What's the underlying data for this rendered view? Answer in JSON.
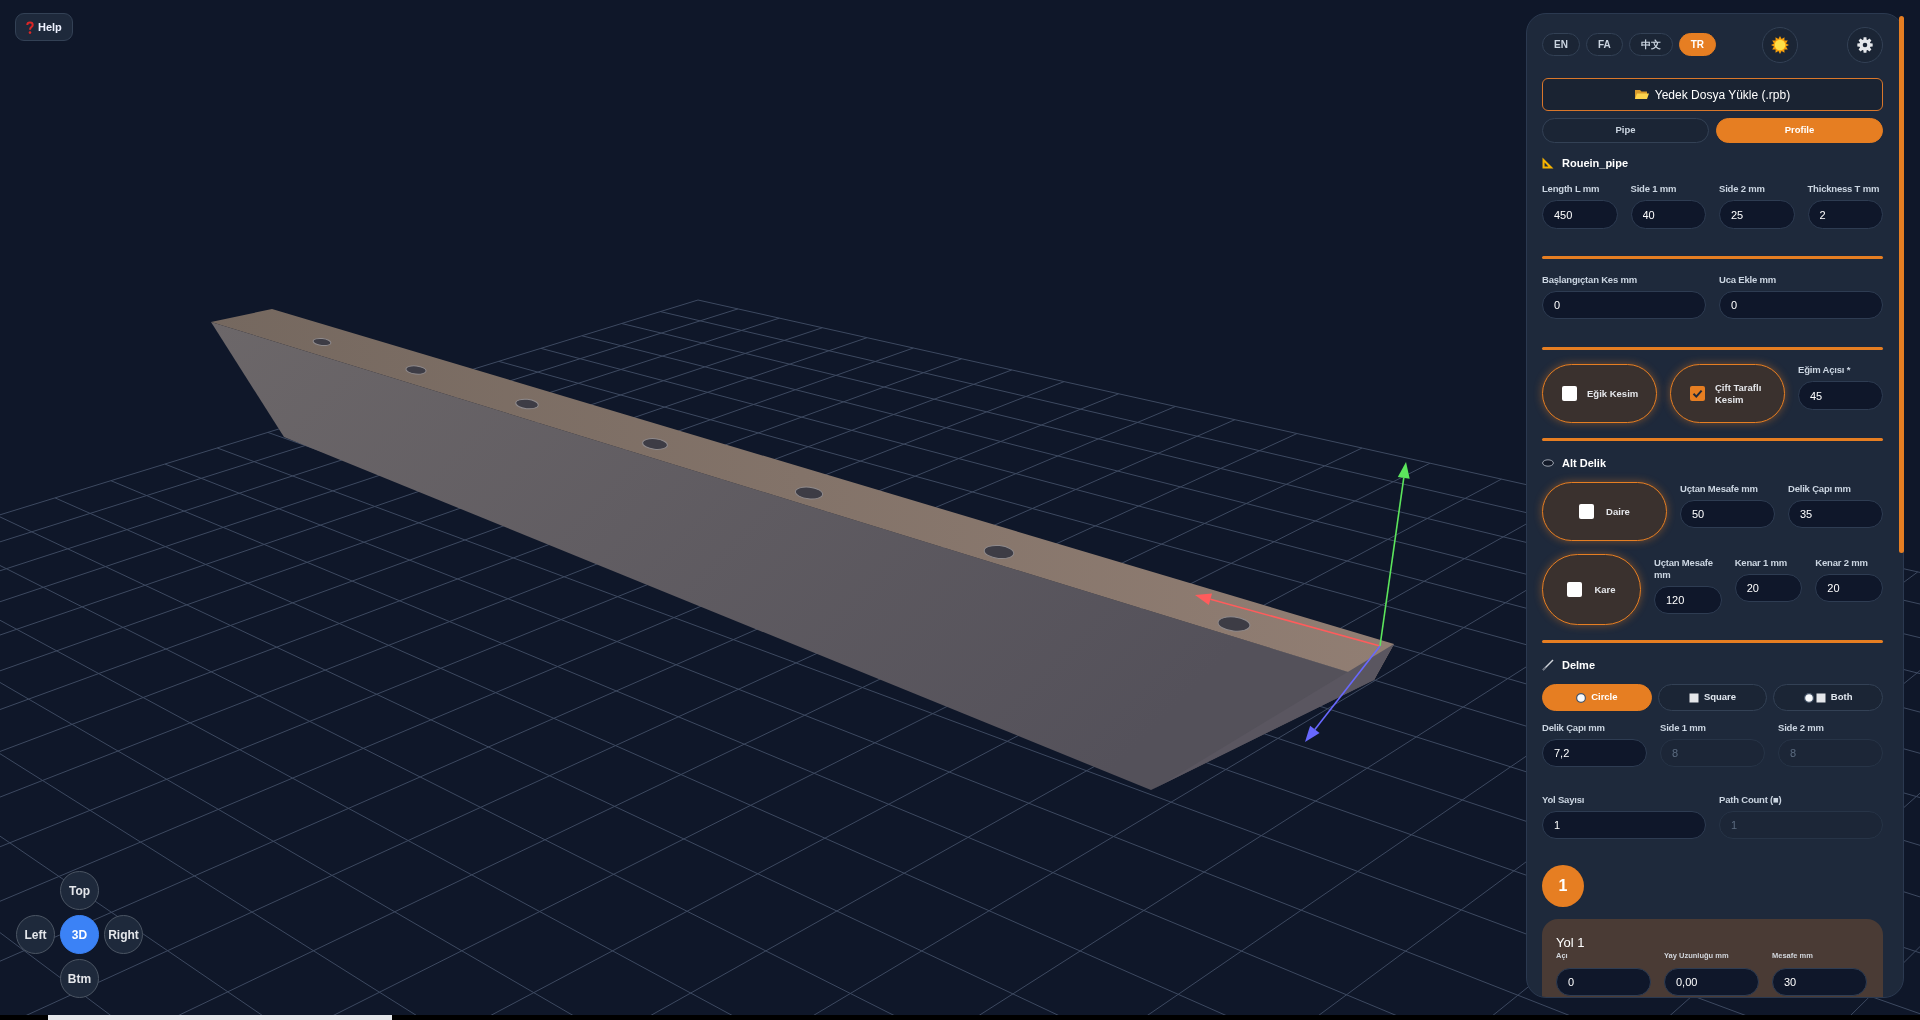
{
  "help_button": {
    "label": "Help"
  },
  "view_buttons": [
    {
      "label": "Top",
      "selected": false
    },
    {
      "label": "Left",
      "selected": false
    },
    {
      "label": "3D",
      "selected": true
    },
    {
      "label": "Right",
      "selected": false
    },
    {
      "label": "Btm",
      "selected": false
    }
  ],
  "panel": {
    "languages": [
      {
        "label": "EN",
        "selected": false
      },
      {
        "label": "FA",
        "selected": false
      },
      {
        "label": "中文",
        "selected": false
      },
      {
        "label": "TR",
        "selected": true
      }
    ],
    "load_button": {
      "label": "Yedek Dosya Yükle (.rpb)"
    },
    "mode_tabs": [
      {
        "label": "Pipe",
        "selected": false
      },
      {
        "label": "Profile",
        "selected": true
      }
    ],
    "profile": {
      "title": "Rouein_pipe",
      "fields": [
        {
          "label": "Length L mm",
          "value": "450"
        },
        {
          "label": "Side 1 mm",
          "value": "40"
        },
        {
          "label": "Side 2 mm",
          "value": "25"
        },
        {
          "label": "Thickness T mm",
          "value": "2"
        }
      ]
    },
    "trim": {
      "fields": [
        {
          "label": "Başlangıçtan Kes mm",
          "value": "0"
        },
        {
          "label": "Uca Ekle mm",
          "value": "0"
        }
      ]
    },
    "cut": {
      "toggles": [
        {
          "label": "Eğik Kesim",
          "checked": false
        },
        {
          "label": "Çift Taraflı Kesim",
          "checked": true
        }
      ],
      "angle": {
        "label": "Eğim Açısı *",
        "value": "45"
      }
    },
    "bottom_hole": {
      "title": "Alt Delik",
      "rows": [
        {
          "toggle": {
            "label": "Daire",
            "checked": false
          },
          "fields": [
            {
              "label": "Uçtan Mesafe mm",
              "value": "50"
            },
            {
              "label": "Delik Çapı mm",
              "value": "35"
            }
          ]
        },
        {
          "toggle": {
            "label": "Kare",
            "checked": false
          },
          "fields": [
            {
              "label": "Uçtan Mesafe mm",
              "value": "120"
            },
            {
              "label": "Kenar 1 mm",
              "value": "20"
            },
            {
              "label": "Kenar 2 mm",
              "value": "20"
            }
          ]
        }
      ]
    },
    "drilling": {
      "title": "Delme",
      "shapes": [
        {
          "label": "Circle",
          "kind": "circle",
          "selected": true
        },
        {
          "label": "Square",
          "kind": "square",
          "selected": false
        },
        {
          "label": "Both",
          "kind": "both",
          "selected": false
        }
      ],
      "fields": [
        {
          "label": "Delik Çapı mm",
          "value": "7,2",
          "disabled": false
        },
        {
          "label": "Side 1 mm",
          "value": "8",
          "disabled": true
        },
        {
          "label": "Side 2 mm",
          "value": "8",
          "disabled": true
        }
      ],
      "path_fields": [
        {
          "label": "Yol Sayısı",
          "value": "1",
          "disabled": false
        },
        {
          "label": "Path Count (■)",
          "value": "1",
          "disabled": true
        }
      ]
    },
    "path_badge": {
      "label": "1"
    },
    "paths": [
      {
        "title": "Yol 1",
        "fields": [
          {
            "label": "Açı",
            "value": "0"
          },
          {
            "label": "Yay Uzunluğu mm",
            "value": "0,00"
          },
          {
            "label": "Mesafe mm",
            "value": "30"
          }
        ]
      }
    ]
  }
}
